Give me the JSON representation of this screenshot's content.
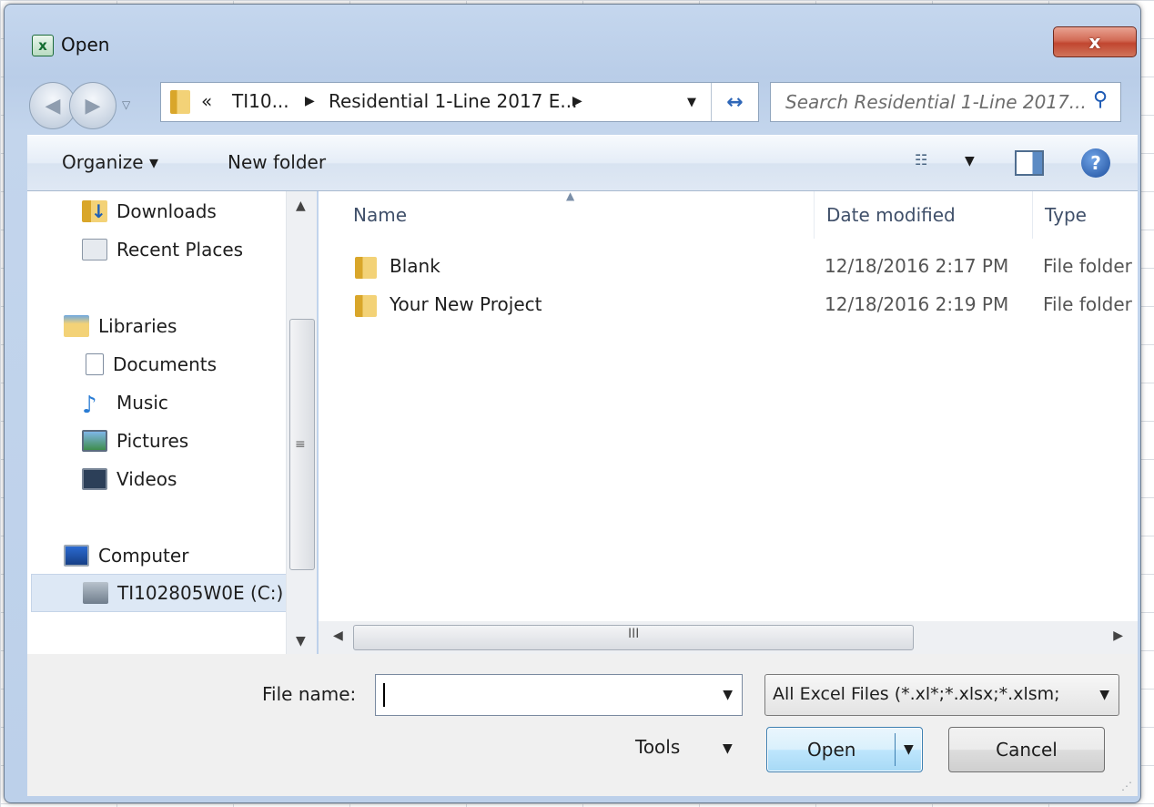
{
  "window": {
    "title": "Open",
    "app_icon": "excel-icon",
    "close_label": "x"
  },
  "navigation": {
    "address": {
      "overflow": "«",
      "segment1": "TI10...",
      "segment2": "Residential 1-Line 2017 E..."
    },
    "search_placeholder": "Search Residential 1-Line 2017..."
  },
  "toolbar": {
    "organize": "Organize ▾",
    "new_folder": "New folder",
    "views_icon": "views-icon",
    "help_icon": "help-icon"
  },
  "sidebar": {
    "items": [
      {
        "label": "Downloads",
        "icon": "downloads-icon"
      },
      {
        "label": "Recent Places",
        "icon": "recent-places-icon"
      },
      {
        "label": "Libraries",
        "icon": "libraries-icon"
      },
      {
        "label": "Documents",
        "icon": "documents-icon"
      },
      {
        "label": "Music",
        "icon": "music-icon"
      },
      {
        "label": "Pictures",
        "icon": "pictures-icon"
      },
      {
        "label": "Videos",
        "icon": "videos-icon"
      },
      {
        "label": "Computer",
        "icon": "computer-icon"
      },
      {
        "label": "TI102805W0E (C:)",
        "icon": "drive-icon",
        "selected": true
      }
    ]
  },
  "filelist": {
    "columns": [
      "Name",
      "Date modified",
      "Type"
    ],
    "rows": [
      {
        "name": "Blank",
        "date": "12/18/2016 2:17 PM",
        "type": "File folder"
      },
      {
        "name": "Your New Project",
        "date": "12/18/2016 2:19 PM",
        "type": "File folder"
      }
    ]
  },
  "bottom": {
    "file_name_label": "File name:",
    "file_name_value": "",
    "filter": "All Excel Files (*.xl*;*.xlsx;*.xlsm;",
    "tools": "Tools",
    "open": "Open",
    "cancel": "Cancel"
  }
}
